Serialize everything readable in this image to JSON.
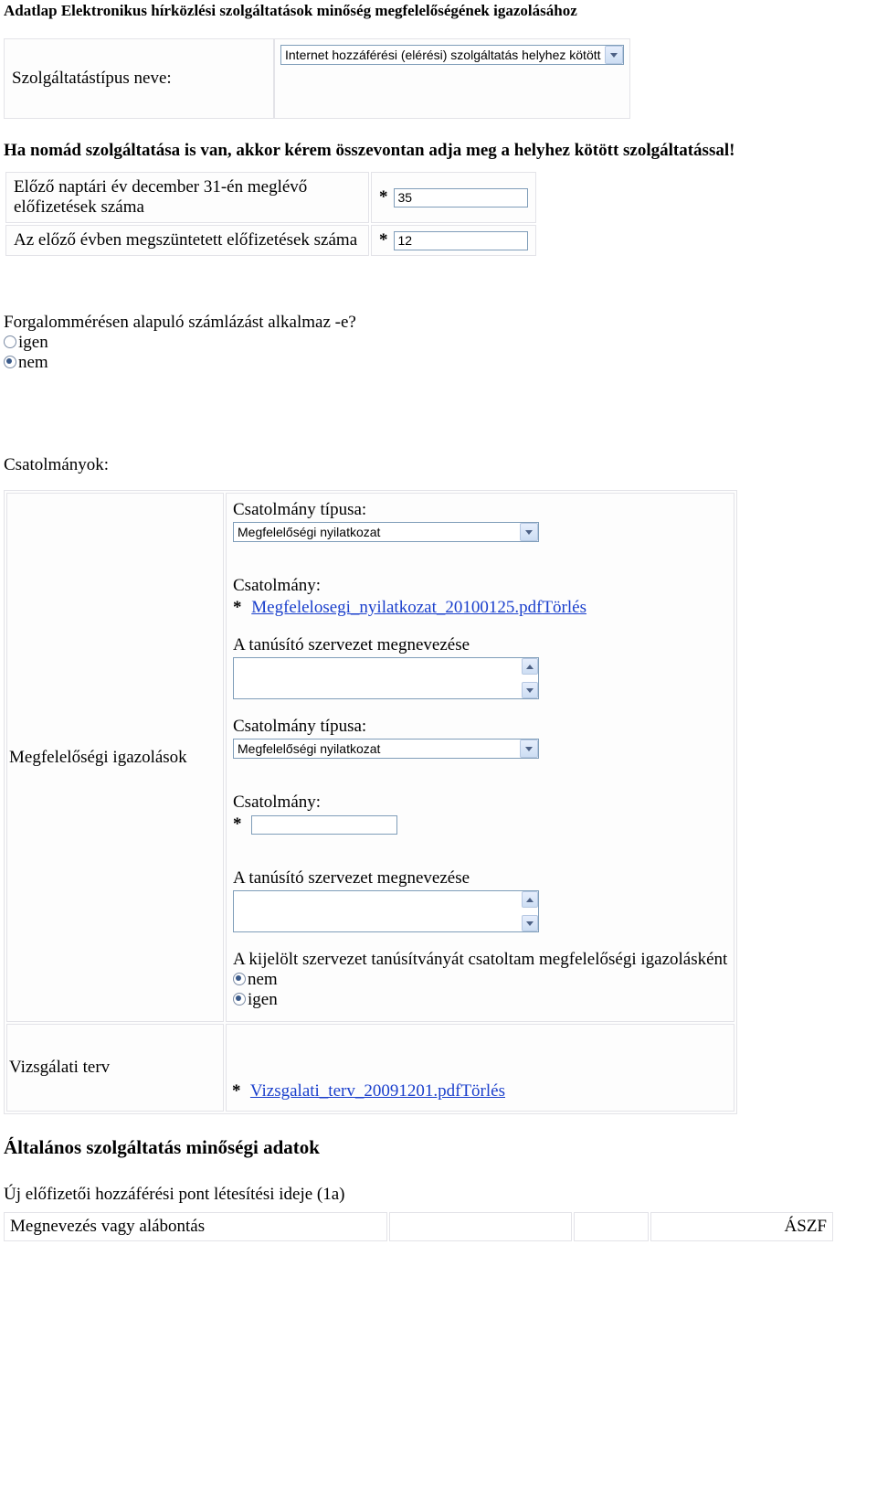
{
  "page_title": "Adatlap Elektronikus hírközlési szolgáltatások minőség megfelelőségének igazolásához",
  "service_type": {
    "label": "Szolgáltatástípus neve:",
    "selected": "Internet hozzáférési (elérési) szolgáltatás helyhez kötött"
  },
  "nomad_note": "Ha nomád szolgáltatása is van, akkor kérem összevontan adja meg a helyhez kötött szolgáltatással!",
  "rows": {
    "prev_year_subs": {
      "label": "Előző naptári év december 31-én meglévő előfizetések száma",
      "value": "35"
    },
    "discontinued": {
      "label": "Az előző évben megszüntetett előfizetések száma",
      "value": "12"
    }
  },
  "billing": {
    "question": "Forgalommérésen alapuló számlázást alkalmaz -e?",
    "yes": "igen",
    "no": "nem"
  },
  "attachments": {
    "heading": "Csatolmányok:",
    "left_label": "Megfelelőségi igazolások",
    "type_label": "Csatolmány típusa:",
    "type_value": "Megfelelőségi nyilatkozat",
    "file_label": "Csatolmány:",
    "file1_name": "Megfelelosegi_nyilatkozat_20100125.pdf",
    "delete_label": "Törlés",
    "org_label": "A tanúsító szervezet megnevezése",
    "cert_statement": "A kijelölt szervezet tanúsítványát csatoltam megfelelőségi igazolásként",
    "cert_no": "nem",
    "cert_yes": "igen",
    "vizs_left": "Vizsgálati terv",
    "vizs_file": "Vizsgalati_terv_20091201.pdf"
  },
  "general": {
    "heading": "Általános szolgáltatás minőségi adatok",
    "sub1": "Új előfizetői hozzáférési pont létesítési ideje (1a)",
    "col1": "Megnevezés vagy alábontás",
    "col4": "ÁSZF"
  }
}
